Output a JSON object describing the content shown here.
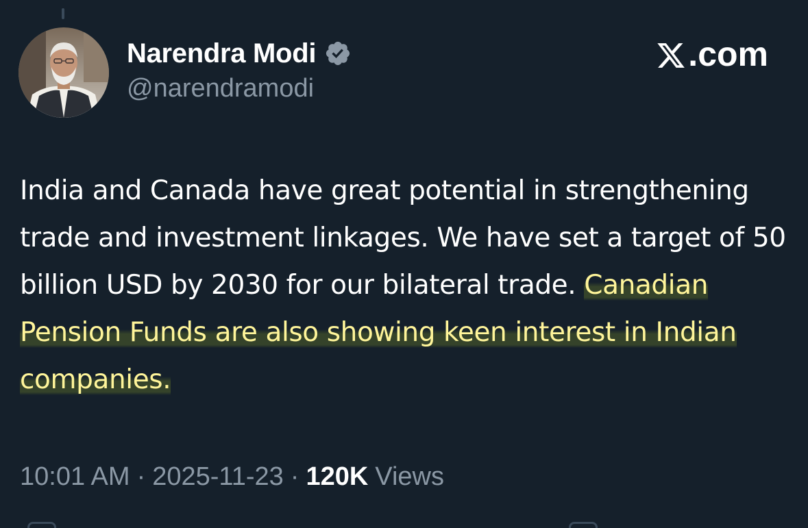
{
  "window": {
    "brand": "X.com"
  },
  "tweet": {
    "author": {
      "display_name": "Narendra Modi",
      "handle": "@narendramodi",
      "verified": true,
      "avatar_icon": "profile-photo"
    },
    "text_plain": "India and Canada have great potential in strengthening trade and investment linkages. We have set a target of 50 billion USD by 2030 for our bilateral trade. ",
    "text_highlighted": "Canadian Pension Funds are also showing keen interest in Indian companies.",
    "meta": {
      "time": "10:01 AM",
      "date": "2025-11-23",
      "separator": "·",
      "views_count": "120K",
      "views_label": "Views"
    }
  },
  "colors": {
    "background": "#15202b",
    "primary_text": "#ffffff",
    "secondary_text": "#8b98a5",
    "highlight_text": "#fff59a",
    "verified_badge": "#8b98a5"
  },
  "icons": {
    "verified": "verified-badge-icon",
    "logo": "x-logo-icon"
  }
}
